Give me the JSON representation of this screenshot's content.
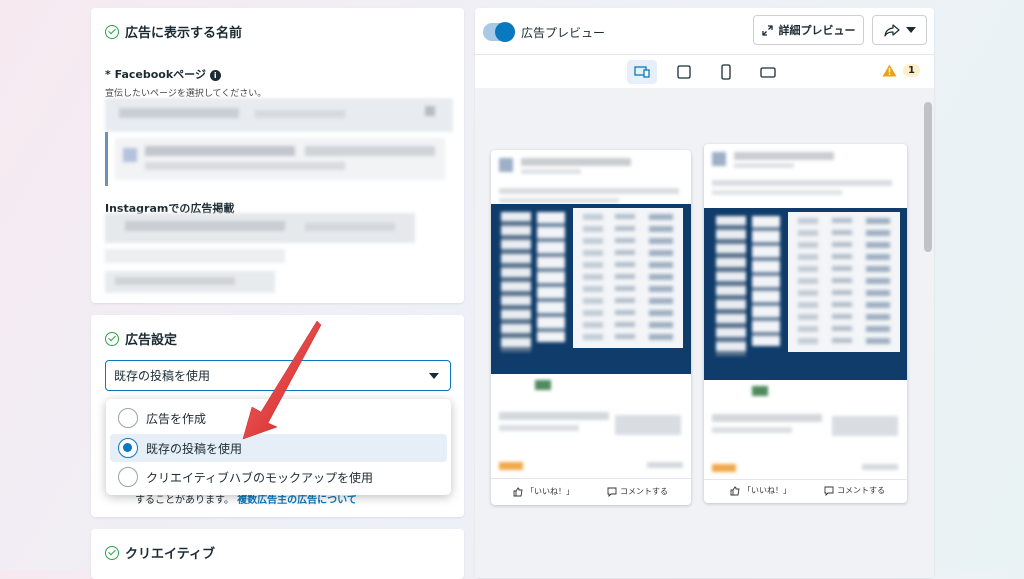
{
  "left": {
    "section1": {
      "title": "広告に表示する名前",
      "facebook_label": "* Facebookページ",
      "facebook_help": "宣伝したいページを選択してください。",
      "instagram_label": "Instagramでの広告掲載"
    },
    "section2": {
      "title": "広告設定",
      "select_value": "既存の投稿を使用",
      "options": [
        {
          "label": "広告を作成",
          "selected": false
        },
        {
          "label": "既存の投稿を使用",
          "selected": true
        },
        {
          "label": "クリエイティブハブのモックアップを使用",
          "selected": false
        }
      ],
      "footnote_prefix": "することがあります。",
      "footnote_link": "複数広告主の広告について"
    },
    "section3": {
      "title": "クリエイティブ"
    }
  },
  "preview": {
    "toggle_label": "広告プレビュー",
    "detail_button": "詳細プレビュー",
    "warning_count": "1",
    "cards": [
      {
        "like": "「いいね！」",
        "comment": "コメントする"
      },
      {
        "like": "「いいね！」",
        "comment": "コメントする"
      }
    ]
  },
  "colors": {
    "accent": "#0a78be",
    "check": "#31a24c",
    "warning": "#e8a317",
    "arrow": "#e53935",
    "ad_dark": "#0f3c6a"
  }
}
